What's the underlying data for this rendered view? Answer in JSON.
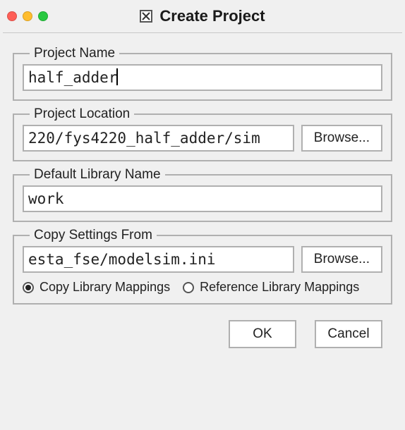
{
  "window": {
    "title": "Create Project"
  },
  "project_name": {
    "legend": "Project Name",
    "value": "half_adder"
  },
  "project_location": {
    "legend": "Project Location",
    "value": "220/fys4220_half_adder/sim",
    "browse_label": "Browse..."
  },
  "default_library": {
    "legend": "Default Library Name",
    "value": "work"
  },
  "copy_settings": {
    "legend": "Copy Settings From",
    "value": "esta_fse/modelsim.ini",
    "browse_label": "Browse...",
    "radio_copy": "Copy Library Mappings",
    "radio_reference": "Reference Library Mappings",
    "selected": "copy"
  },
  "buttons": {
    "ok": "OK",
    "cancel": "Cancel"
  }
}
